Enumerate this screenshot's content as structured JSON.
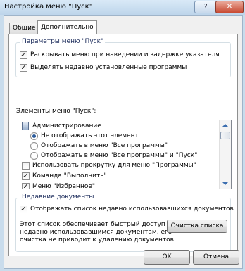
{
  "window": {
    "title": "Настройка меню \"Пуск\"",
    "help_glyph": "?",
    "close_glyph": "✕"
  },
  "tabs": [
    {
      "label": "Общие",
      "selected": false
    },
    {
      "label": "Дополнительно",
      "selected": true
    }
  ],
  "start_menu_params": {
    "legend": "Параметры меню \"Пуск\"",
    "options": [
      {
        "label": "Раскрывать меню при наведении и задержке указателя",
        "checked": true
      },
      {
        "label": "Выделять недавно установленные программы",
        "checked": true
      }
    ]
  },
  "elements": {
    "label": "Элементы меню \"Пуск\":",
    "items": [
      {
        "label": "Администрирование"
      },
      {
        "label": "Не отображать этот элемент",
        "selected": true
      },
      {
        "label": "Отображать в меню \"Все программы\"",
        "selected": false
      },
      {
        "label": "Отображать в меню \"Все программы\" и \"Пуск\"",
        "selected": false
      },
      {
        "label": "Использовать прокрутку для меню \"Программы\"",
        "checked": false
      },
      {
        "label": "Команда \"Выполнить\"",
        "checked": true
      },
      {
        "label": "Меню \"Избранное\"",
        "checked": true
      }
    ]
  },
  "recent_docs": {
    "legend": "Недавние документы",
    "checkbox": {
      "label": "Отображать список недавно использовавшихся документов",
      "checked": true
    },
    "description": [
      "Этот список обеспечивает быстрый доступ к",
      "недавно использовавшимся документам, его",
      "очистка не приводит к удалению документов."
    ],
    "clear_button": "Очистка списка"
  },
  "buttons": {
    "ok": "OK",
    "cancel": "Отмена"
  },
  "colors": {
    "accent": "#2a5a9a",
    "legend_text": "#1a2a5a"
  }
}
